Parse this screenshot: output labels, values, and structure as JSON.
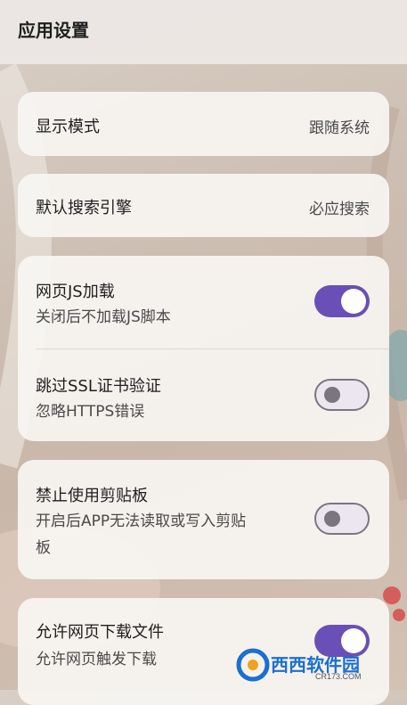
{
  "header": {
    "title": "应用设置"
  },
  "display_mode": {
    "label": "显示模式",
    "value": "跟随系统"
  },
  "search_engine": {
    "label": "默认搜索引擎",
    "value": "必应搜索"
  },
  "web_js": {
    "label": "网页JS加载",
    "desc": "关闭后不加载JS脚本",
    "enabled": true
  },
  "skip_ssl": {
    "label": "跳过SSL证书验证",
    "desc": "忽略HTTPS错误",
    "enabled": false
  },
  "clipboard": {
    "label": "禁止使用剪贴板",
    "desc_line1": "开启后APP无法读取或写入剪贴",
    "desc_line2": "板",
    "enabled": false
  },
  "download": {
    "label": "允许网页下载文件",
    "desc": "允许网页触发下载",
    "enabled": true
  },
  "watermark": {
    "text": "西西软件园",
    "sub": "CR173.COM"
  },
  "colors": {
    "accent": "#6a4fb6",
    "switch_off_track": "#ece6f0",
    "switch_off_knob": "#7b7582"
  }
}
